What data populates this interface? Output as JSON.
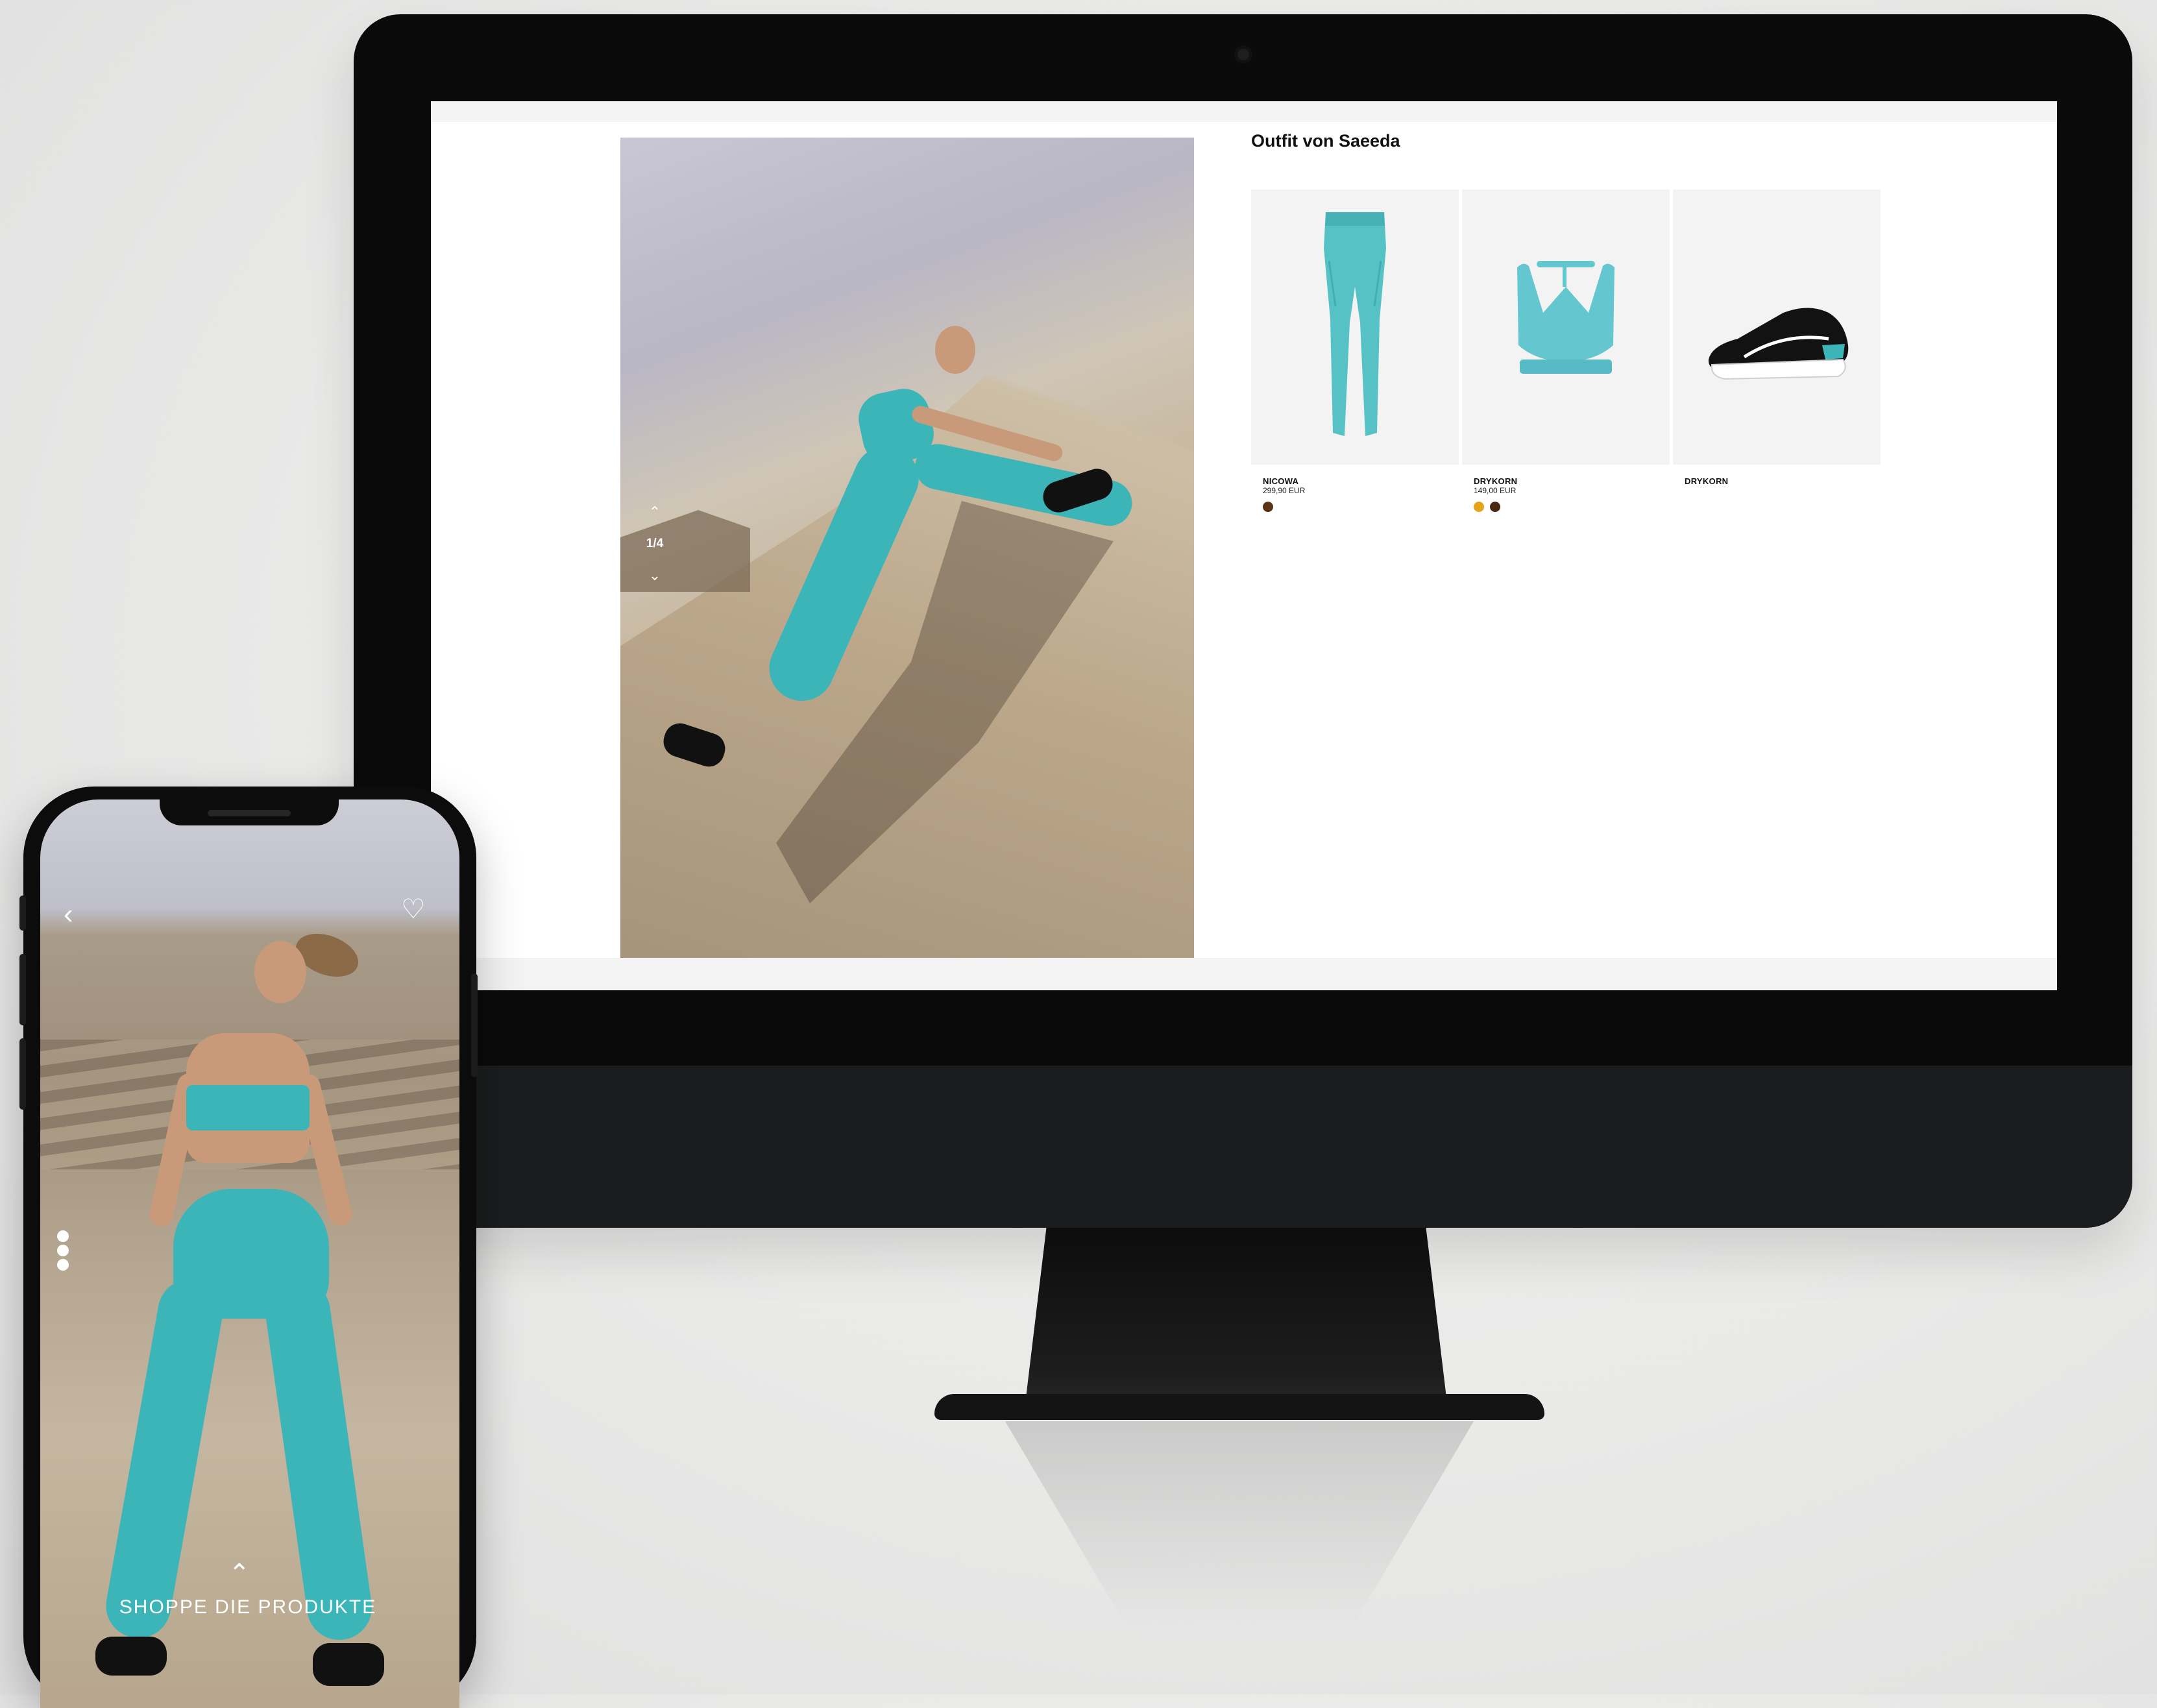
{
  "desktop": {
    "pager": {
      "up": "⌃",
      "count": "1/4",
      "down": "⌄"
    },
    "outfit_title": "Outfit von Saeeda",
    "products": [
      {
        "brand": "NICOWA",
        "price": "299,90 EUR",
        "swatches": [
          "#5a3416"
        ]
      },
      {
        "brand": "DRYKORN",
        "price": "149,00 EUR",
        "swatches": [
          "#e6a317",
          "#4a2610"
        ]
      },
      {
        "brand": "DRYKORN",
        "price": "",
        "swatches": []
      }
    ],
    "colors": {
      "teal": "#3cb5b9",
      "background": "#ffffff"
    }
  },
  "mobile": {
    "back_icon": "‹",
    "heart_icon": "♡",
    "up_icon": "⌃",
    "cta_label": "SHOPPE DIE PRODUKTE"
  }
}
